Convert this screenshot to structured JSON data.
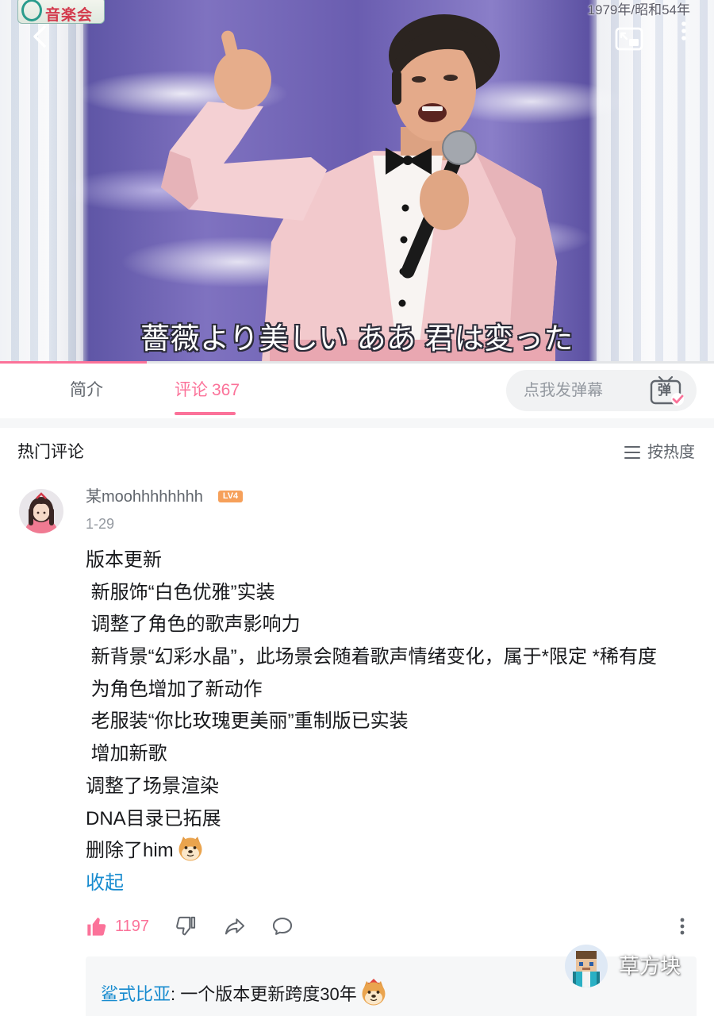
{
  "app": {
    "accent_color": "#fb7299",
    "link_color": "#178bcf"
  },
  "video": {
    "logo_text": "音楽会",
    "year_text": "1979年/昭和54年",
    "subtitle": "薔薇より美しい ああ 君は変った",
    "progress": 0.205,
    "icons": [
      "back-icon",
      "pip-icon",
      "more-vertical-icon"
    ]
  },
  "tabs": [
    {
      "label": "简介",
      "active": false
    },
    {
      "label": "评论",
      "count": "367",
      "active": true
    }
  ],
  "danmaku": {
    "placeholder": "点我发弹幕",
    "button_label": "弹",
    "icon": "danmaku-icon"
  },
  "hot_comments": {
    "title": "热门评论",
    "sort_label": "按热度",
    "sort_icon": "list-icon"
  },
  "comment": {
    "username": "某moohhhhhhhh",
    "level": "LV4",
    "date": "1-29",
    "lines": [
      "版本更新",
      " 新服饰“白色优雅”实装",
      " 调整了角色的歌声影响力",
      " 新背景“幻彩水晶”，此场景会随着歌声情绪变化，属于*限定 *稀有度",
      " 为角色增加了新动作",
      " 老服装“你比玫瑰更美丽”重制版已实装",
      " 增加新歌",
      "调整了场景渲染",
      "DNA目录已拓展",
      "删除了him"
    ],
    "last_line_emoji": "doge-emoji",
    "collapse_label": "收起",
    "like_count": "1197",
    "liked": true,
    "action_icons": [
      "thumbs-up-icon",
      "thumbs-down-icon",
      "share-icon",
      "comment-icon",
      "more-vertical-icon"
    ],
    "reply": {
      "author": "鲨式比亚",
      "separator": ":",
      "text": "一个版本更新跨度30年",
      "emoji": "doge-emoji"
    }
  },
  "watermark": {
    "text": "草方块"
  }
}
